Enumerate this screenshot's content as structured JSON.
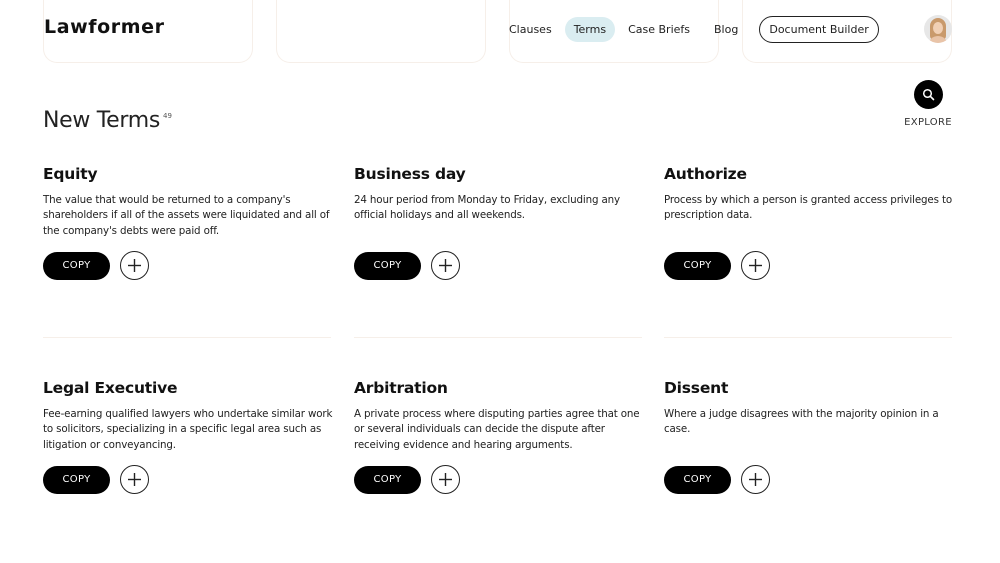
{
  "header": {
    "logo": "Lawformer",
    "nav": [
      {
        "label": "Clauses",
        "active": false
      },
      {
        "label": "Terms",
        "active": true
      },
      {
        "label": "Case Briefs",
        "active": false
      },
      {
        "label": "Blog",
        "active": false
      }
    ],
    "cta_label": "Document Builder",
    "avatar_icon": "user-avatar",
    "active_color": "#daedf1"
  },
  "section": {
    "title": "New Terms",
    "count": "49",
    "explore_label": "EXPLORE",
    "explore_icon": "search-icon"
  },
  "terms": [
    {
      "title": "Equity",
      "definition": "The value that would be returned to a company's shareholders if all of the assets were liquidated and all of the company's debts were paid off.",
      "copy_label": "COPY",
      "add_icon": "plus-icon"
    },
    {
      "title": "Business day",
      "definition": "24 hour period from Monday to Friday, excluding any official holidays and all weekends.",
      "copy_label": "COPY",
      "add_icon": "plus-icon"
    },
    {
      "title": "Authorize",
      "definition": "Process by which a person is granted access privileges to prescription data.",
      "copy_label": "COPY",
      "add_icon": "plus-icon"
    },
    {
      "title": "Legal Executive",
      "definition": "Fee-earning qualified lawyers who undertake similar work to solicitors, specializing in a specific legal area such as litigation or conveyancing.",
      "copy_label": "COPY",
      "add_icon": "plus-icon"
    },
    {
      "title": "Arbitration",
      "definition": "A private process where disputing parties agree that one or several individuals can decide the dispute after receiving evidence and hearing arguments.",
      "copy_label": "COPY",
      "add_icon": "plus-icon"
    },
    {
      "title": "Dissent",
      "definition": "Where a judge disagrees with the majority opinion in a case.",
      "copy_label": "COPY",
      "add_icon": "plus-icon"
    }
  ]
}
